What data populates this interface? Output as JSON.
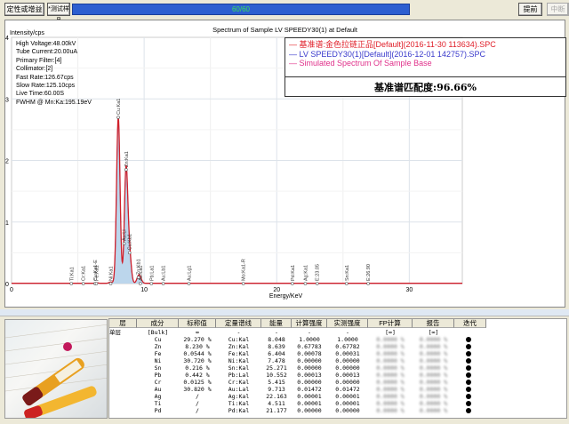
{
  "toolbar": {
    "qual_label": "定性或增益",
    "test_label": "*测试样品",
    "progress_text": "60/60",
    "progress": 1.0,
    "advance_label": "提前",
    "abort_label": "中断"
  },
  "chart_data": {
    "type": "line",
    "title": "Spectrum of Sample LV SPEEDY30(1) at Default",
    "ylabel": "Intensity/cps",
    "xlabel": "Energy/KeV",
    "xlim": [
      0,
      34
    ],
    "ylim": [
      0,
      4
    ],
    "x_ticks": [
      0,
      10,
      20,
      30
    ],
    "y_ticks": [
      0,
      1,
      2,
      3,
      4
    ],
    "grid": true,
    "legend_placement": "top-right",
    "legend": [
      {
        "name": "基准谱:金色拉链正品[Default](2016-11-30 113634).SPC",
        "color": "#e0202a"
      },
      {
        "name": "LV SPEEDY30(1)[Default](2016-12-01 142757).SPC",
        "color": "#3a3acc"
      },
      {
        "name": "Simulated Spectrum Of Sample Base",
        "color": "#e0308a"
      }
    ],
    "match_text": "基准谱匹配度:96.66%",
    "info": [
      "High Voltage:48.00kV",
      "Tube Current:20.00uA",
      "Primary Filter:[4]",
      "Collimator:[2]",
      "Fast Rate:126.67cps",
      "Slow Rate:125.10cps",
      "Live Time:60.00S",
      "FWHM @ Mn:Ka:195.19eV"
    ],
    "peaks": [
      {
        "x": 8.05,
        "y": 2.7
      },
      {
        "x": 8.64,
        "y": 1.85
      },
      {
        "x": 8.9,
        "y": 0.45
      },
      {
        "x": 9.57,
        "y": 0.1
      },
      {
        "x": 9.71,
        "y": 0.06
      },
      {
        "x": 7.48,
        "y": 0.02
      },
      {
        "x": 6.4,
        "y": 0.01
      }
    ],
    "markers": [
      {
        "label": "Ti:Ka1",
        "x": 4.51
      },
      {
        "label": "Cr:Ka1",
        "x": 5.41
      },
      {
        "label": "Cu:Ka1-E",
        "x": 6.3
      },
      {
        "label": "Fe:Ka1",
        "x": 6.4
      },
      {
        "label": "Ni:Ka1",
        "x": 7.48
      },
      {
        "label": "Cu:Ka1",
        "x": 8.05,
        "y": 2.7
      },
      {
        "label": "Au:Ll",
        "x": 8.49,
        "y": 0.65
      },
      {
        "label": "Zn:Ka1",
        "x": 8.64,
        "y": 1.85
      },
      {
        "label": "Cu:Kb1",
        "x": 8.9,
        "y": 0.5
      },
      {
        "label": "Zn:Kb1",
        "x": 9.57,
        "y": 0.1
      },
      {
        "label": "Au:La1",
        "x": 9.71
      },
      {
        "label": "Pb:La1",
        "x": 10.55
      },
      {
        "label": "Au:Lb1",
        "x": 11.44
      },
      {
        "label": "Au:Lg1",
        "x": 13.38
      },
      {
        "label": "Mo:Ka1-R",
        "x": 17.48
      },
      {
        "label": "Pd:Ka1",
        "x": 21.18
      },
      {
        "label": "Ag:Ka1",
        "x": 22.16
      },
      {
        "label": "E:23.05",
        "x": 23.05
      },
      {
        "label": "Sn:Ka1",
        "x": 25.27
      },
      {
        "label": "E:26.90",
        "x": 26.9
      }
    ]
  },
  "table": {
    "headers": [
      "层",
      "成分",
      "标称值",
      "定量谱线",
      "能量",
      "计算强度",
      "实测强度",
      "FP计算",
      "报告",
      "迭代"
    ],
    "layer": "单层",
    "bulk_row": [
      "[Bulk]",
      "∞",
      "-",
      "-",
      "-",
      "-",
      "[∞]",
      "[∞]"
    ],
    "rows": [
      [
        "Cu",
        "29.270 %",
        "Cu:Kal",
        "8.048",
        "1.0000",
        "1.0000"
      ],
      [
        "Zn",
        "8.230 %",
        "Zn:Kal",
        "8.639",
        "0.67783",
        "0.67782"
      ],
      [
        "Fe",
        "0.0544 %",
        "Fe:Kal",
        "6.404",
        "0.00078",
        "0.00031"
      ],
      [
        "Ni",
        "30.720 %",
        "Ni:Kal",
        "7.478",
        "0.00000",
        "0.00000"
      ],
      [
        "Sn",
        "0.216 %",
        "Sn:Kal",
        "25.271",
        "0.00000",
        "0.00000"
      ],
      [
        "Pb",
        "0.442 %",
        "Pb:Lal",
        "10.552",
        "0.00013",
        "0.00013"
      ],
      [
        "Cr",
        "0.0125 %",
        "Cr:Kal",
        "5.415",
        "0.00000",
        "0.00000"
      ],
      [
        "Au",
        "30.820 %",
        "Au:Lal",
        "9.713",
        "0.01472",
        "0.01472"
      ],
      [
        "Ag",
        "/",
        "Ag:Kal",
        "22.163",
        "0.00001",
        "0.00001"
      ],
      [
        "Ti",
        "/",
        "Ti:Kal",
        "4.511",
        "0.00001",
        "0.00001"
      ],
      [
        "Pd",
        "/",
        "Pd:Kal",
        "21.177",
        "0.00000",
        "0.00000"
      ]
    ]
  }
}
